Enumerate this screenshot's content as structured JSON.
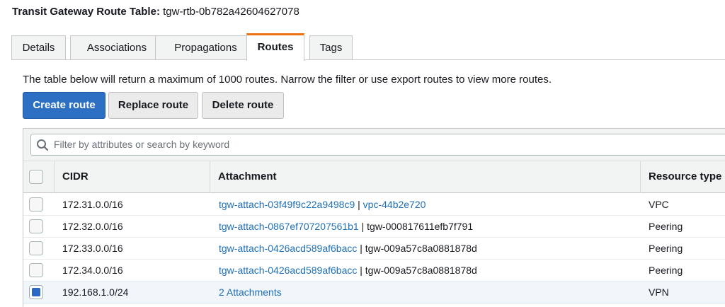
{
  "header": {
    "label": "Transit Gateway Route Table:",
    "route_table_id": "tgw-rtb-0b782a42604627078"
  },
  "tabs": [
    {
      "label": "Details",
      "active": false
    },
    {
      "label": "Associations",
      "active": false
    },
    {
      "label": "Propagations",
      "active": false
    },
    {
      "label": "Routes",
      "active": true
    },
    {
      "label": "Tags",
      "active": false
    }
  ],
  "routes_panel": {
    "notice": "The table below will return a maximum of 1000 routes. Narrow the filter or use export routes to view more routes.",
    "buttons": {
      "create": "Create route",
      "replace": "Replace route",
      "delete": "Delete route"
    },
    "filter": {
      "placeholder": "Filter by attributes or search by keyword",
      "value": ""
    },
    "columns": {
      "cidr": "CIDR",
      "attachment": "Attachment",
      "resource_type": "Resource type"
    },
    "rows": [
      {
        "checked": false,
        "cidr": "172.31.0.0/16",
        "attachment": "tgw-attach-03f49f9c22a9498c9",
        "separator": "|",
        "resource_id": "vpc-44b2e720",
        "resource_id_link": true,
        "resource_type": "VPC"
      },
      {
        "checked": false,
        "cidr": "172.32.0.0/16",
        "attachment": "tgw-attach-0867ef707207561b1",
        "separator": "|",
        "resource_id": "tgw-000817611efb7f791",
        "resource_id_link": false,
        "resource_type": "Peering"
      },
      {
        "checked": false,
        "cidr": "172.33.0.0/16",
        "attachment": "tgw-attach-0426acd589af6bacc",
        "separator": "|",
        "resource_id": "tgw-009a57c8a0881878d",
        "resource_id_link": false,
        "resource_type": "Peering"
      },
      {
        "checked": false,
        "cidr": "172.34.0.0/16",
        "attachment": "tgw-attach-0426acd589af6bacc",
        "separator": "|",
        "resource_id": "tgw-009a57c8a0881878d",
        "resource_id_link": false,
        "resource_type": "Peering"
      },
      {
        "checked": true,
        "cidr": "192.168.1.0/24",
        "attachment": "2 Attachments",
        "separator": "",
        "resource_id": "",
        "resource_id_link": false,
        "resource_type": "VPN"
      }
    ]
  },
  "icons": {
    "search": "search-icon",
    "checkbox": "checkbox-icon"
  },
  "colors": {
    "primary_button": "#2d6fc2",
    "link": "#1f6fb4",
    "active_tab_accent": "#ec7211",
    "selected_row": "#f1f6fb",
    "selected_checkbox": "#2c68c3"
  }
}
